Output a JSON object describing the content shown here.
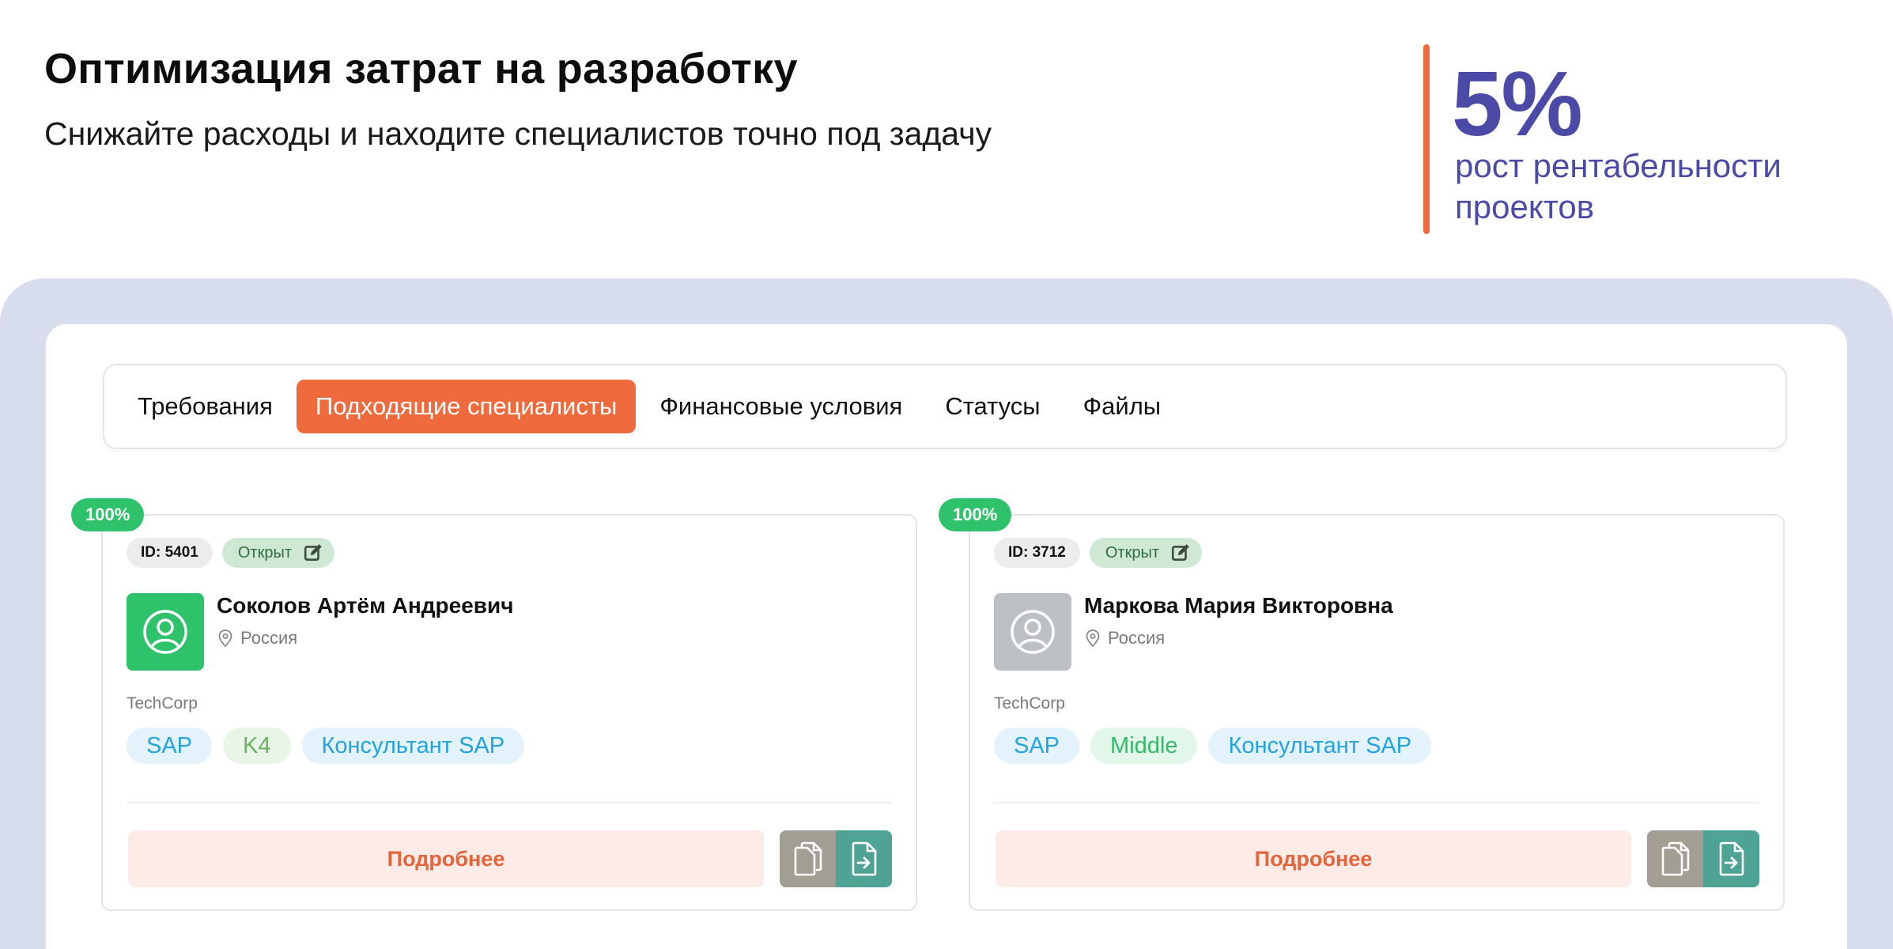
{
  "hero": {
    "title": "Оптимизация затрат на разработку",
    "subtitle": "Снижайте расходы и находите специалистов точно под задачу"
  },
  "stat": {
    "value": "5%",
    "label": "рост рентабельности проектов",
    "color": "#4b4aa6",
    "accent": "#ef6a3d"
  },
  "tabs": [
    {
      "label": "Требования",
      "active": false
    },
    {
      "label": "Подходящие специалисты",
      "active": true
    },
    {
      "label": "Финансовые условия",
      "active": false
    },
    {
      "label": "Статусы",
      "active": false
    },
    {
      "label": "Файлы",
      "active": false
    }
  ],
  "candidates": [
    {
      "match": "100%",
      "id_label": "ID: 5401",
      "status": "Открыт",
      "name": "Соколов Артём Андреевич",
      "location": "Россия",
      "company": "TechCorp",
      "avatar_color": "#2ec36a",
      "tags": [
        "SAP",
        "K4",
        "Консультант SAP"
      ],
      "more_label": "Подробнее",
      "icons": [
        "edit-icon",
        "user-icon",
        "location-pin-icon",
        "copy-icon",
        "file-export-icon"
      ]
    },
    {
      "match": "100%",
      "id_label": "ID: 3712",
      "status": "Открыт",
      "name": "Маркова Мария Викторовна",
      "location": "Россия",
      "company": "TechCorp",
      "avatar_color": "#bcc0c4",
      "tags": [
        "SAP",
        "Middle",
        "Консультант SAP"
      ],
      "more_label": "Подробнее",
      "icons": [
        "edit-icon",
        "user-icon",
        "location-pin-icon",
        "copy-icon",
        "file-export-icon"
      ]
    }
  ]
}
